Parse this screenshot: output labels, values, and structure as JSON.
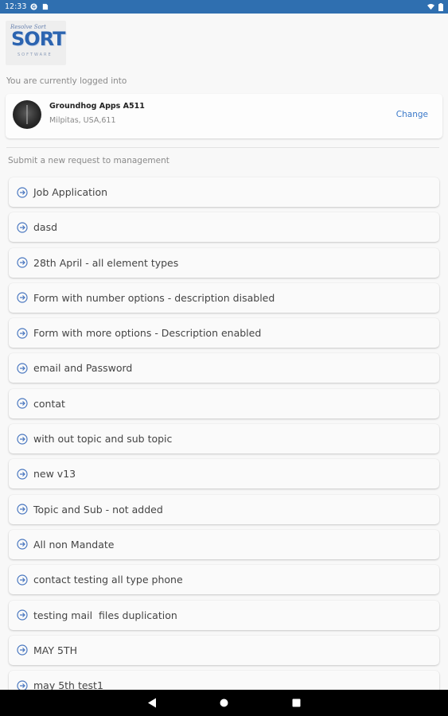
{
  "status_bar": {
    "time": "12:33"
  },
  "logo": {
    "script_text": "Resolve Sort",
    "word": "SORT",
    "sub": "SOFTWARE"
  },
  "account": {
    "label": "You are currently logged into",
    "name": "Groundhog Apps A511",
    "location": "Milpitas, USA,611",
    "change_label": "Change"
  },
  "requests": {
    "label": "Submit a new request to management",
    "items": [
      "Job Application",
      "dasd",
      "28th April - all element types",
      "Form with number options - description disabled",
      "Form with more options - Description enabled",
      "email and Password",
      "contat",
      "with out topic and sub topic",
      "new v13",
      "Topic and Sub - not added",
      "All non Mandate",
      "contact testing all type phone",
      "testing mail  files duplication",
      "MAY 5TH",
      "may 5th test1"
    ]
  },
  "colors": {
    "status_bar": "#2f6fb0",
    "accent": "#3a78c9",
    "nav_bar": "#000000"
  },
  "icons": {
    "status": [
      "g-icon",
      "sd-card-icon",
      "wifi-icon",
      "battery-icon"
    ],
    "item": "arrow-circle-right-icon",
    "nav": [
      "back-icon",
      "home-icon",
      "recents-icon"
    ]
  }
}
